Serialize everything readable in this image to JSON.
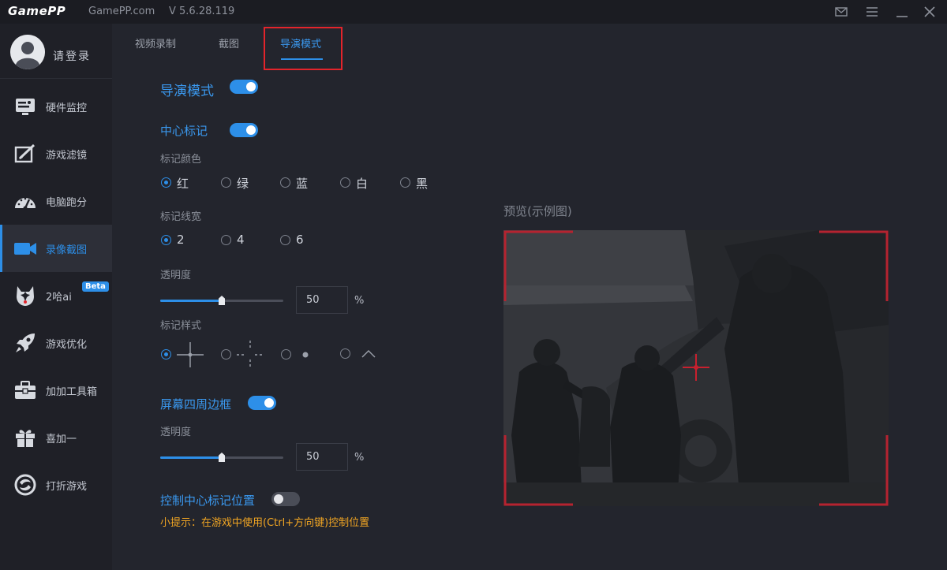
{
  "titlebar": {
    "logo": "GamePP",
    "site": "GamePP.com",
    "version": "V 5.6.28.119",
    "icons": [
      "mail-icon",
      "menu-icon",
      "minimize-icon",
      "close-icon"
    ]
  },
  "sidebar": {
    "login": "请登录",
    "items": [
      {
        "label": "硬件监控",
        "icon": "hardware-monitor-icon"
      },
      {
        "label": "游戏滤镜",
        "icon": "game-filter-icon"
      },
      {
        "label": "电脑跑分",
        "icon": "benchmark-icon"
      },
      {
        "label": "录像截图",
        "icon": "camera-icon",
        "active": true
      },
      {
        "label": "2哈ai",
        "icon": "husky-icon",
        "badge": "Beta"
      },
      {
        "label": "游戏优化",
        "icon": "rocket-icon"
      },
      {
        "label": "加加工具箱",
        "icon": "toolbox-icon"
      },
      {
        "label": "喜加一",
        "icon": "gift-icon"
      },
      {
        "label": "打折游戏",
        "icon": "discount-icon"
      }
    ]
  },
  "tabs": [
    {
      "label": "视频录制"
    },
    {
      "label": "截图"
    },
    {
      "label": "导演模式",
      "active": true
    }
  ],
  "director": {
    "title": "导演模式",
    "enabled": true
  },
  "center_mark": {
    "title": "中心标记",
    "enabled": true,
    "color_label": "标记颜色",
    "colors": [
      "红",
      "绿",
      "蓝",
      "白",
      "黑"
    ],
    "selected_color": "红",
    "width_label": "标记线宽",
    "widths": [
      "2",
      "4",
      "6"
    ],
    "selected_width": "2",
    "opacity_label": "透明度",
    "opacity_value": "50",
    "opacity_unit": "%",
    "style_label": "标记样式",
    "styles": [
      "crosshair-solid",
      "crosshair-dashed",
      "dot",
      "chevron"
    ],
    "selected_style": "crosshair-solid"
  },
  "border": {
    "title": "屏幕四周边框",
    "enabled": true,
    "opacity_label": "透明度",
    "opacity_value": "50",
    "opacity_unit": "%"
  },
  "position_control": {
    "title": "控制中心标记位置",
    "enabled": false,
    "tip": "小提示：在游戏中使用(Ctrl+方向键)控制位置"
  },
  "preview": {
    "label": "预览(示例图)"
  },
  "colors": {
    "accent": "#2d8fe8",
    "tip": "#f2a623",
    "highlight": "#e3242b",
    "marker": "#c8202e"
  }
}
